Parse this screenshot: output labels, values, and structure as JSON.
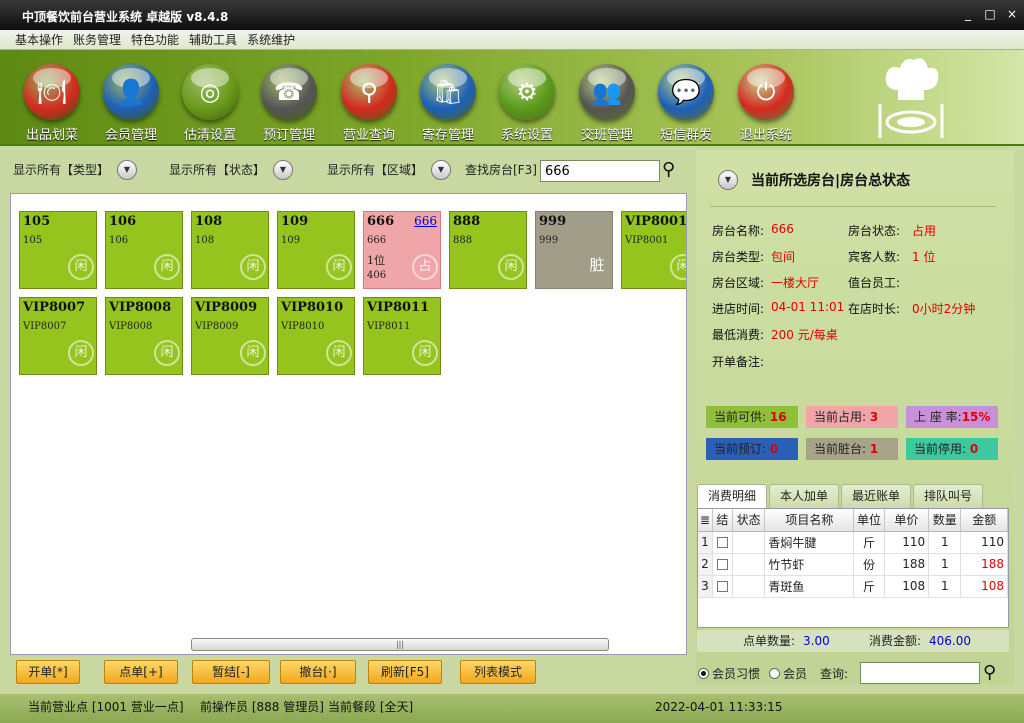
{
  "window": {
    "title": "中顶餐饮前台营业系统 卓越版 v8.4.8",
    "min": "_",
    "max": "□",
    "close": "×"
  },
  "menu": [
    "基本操作",
    "账务管理",
    "特色功能",
    "辅助工具",
    "系统维护"
  ],
  "toolbar": [
    {
      "label": "出品划菜",
      "icon": "dish-cover-icon",
      "glyph": "🍽",
      "color": "#d42a1f"
    },
    {
      "label": "会员管理",
      "icon": "member-icon",
      "glyph": "👤",
      "color": "#1e5fb8"
    },
    {
      "label": "估清设置",
      "icon": "plate-icon",
      "glyph": "◎",
      "color": "#6a9a1a"
    },
    {
      "label": "预订管理",
      "icon": "phone-icon",
      "glyph": "☎",
      "color": "#555555"
    },
    {
      "label": "营业查询",
      "icon": "search-icon",
      "glyph": "⚲",
      "color": "#d42a1f"
    },
    {
      "label": "寄存管理",
      "icon": "bag-icon",
      "glyph": "🛍",
      "color": "#1e5fb8"
    },
    {
      "label": "系统设置",
      "icon": "gear-icon",
      "glyph": "⚙",
      "color": "#5a9a1a"
    },
    {
      "label": "交班管理",
      "icon": "handover-icon",
      "glyph": "👥",
      "color": "#555555"
    },
    {
      "label": "短信群发",
      "icon": "sms-icon",
      "glyph": "💬",
      "color": "#1e5fb8"
    },
    {
      "label": "退出系统",
      "icon": "power-icon",
      "glyph": "⏻",
      "color": "#d42a1f"
    }
  ],
  "filters": {
    "type": "显示所有【类型】",
    "status": "显示所有【状态】",
    "area": "显示所有【区域】",
    "search_label": "查找房台[F3]",
    "search_value": "666",
    "dropdown_glyph": "▼"
  },
  "tables_row1": [
    {
      "no": "105",
      "name": "105",
      "status": "闲",
      "state": "free"
    },
    {
      "no": "106",
      "name": "106",
      "status": "闲",
      "state": "free"
    },
    {
      "no": "108",
      "name": "108",
      "status": "闲",
      "state": "free"
    },
    {
      "no": "109",
      "name": "109",
      "status": "闲",
      "state": "free"
    },
    {
      "no": "666",
      "name": "666",
      "link": "666",
      "guests": "1位",
      "amount": "406",
      "status": "占",
      "state": "occ"
    },
    {
      "no": "888",
      "name": "888",
      "status": "闲",
      "state": "free"
    },
    {
      "no": "999",
      "name": "999",
      "status": "脏",
      "state": "dirty"
    },
    {
      "no": "VIP8001",
      "name": "VIP8001",
      "status": "闲",
      "state": "free"
    }
  ],
  "tables_row2": [
    {
      "no": "VIP8007",
      "name": "VIP8007",
      "status": "闲",
      "state": "free"
    },
    {
      "no": "VIP8008",
      "name": "VIP8008",
      "status": "闲",
      "state": "free"
    },
    {
      "no": "VIP8009",
      "name": "VIP8009",
      "status": "闲",
      "state": "free"
    },
    {
      "no": "VIP8010",
      "name": "VIP8010",
      "status": "闲",
      "state": "free"
    },
    {
      "no": "VIP8011",
      "name": "VIP8011",
      "status": "闲",
      "state": "free"
    }
  ],
  "scroll_grip": "|||",
  "panel": {
    "title": "当前所选房台|房台总状态",
    "room_name_label": "房台名称:",
    "room_name": "666",
    "room_status_label": "房台状态:",
    "room_status": "占用",
    "room_type_label": "房台类型:",
    "room_type": "包间",
    "guests_label": "宾客人数:",
    "guests": "1 位",
    "area_label": "房台区域:",
    "area": "一楼大厅",
    "staff_label": "值台员工:",
    "checkin_label": "进店时间:",
    "checkin": "04-01 11:01",
    "duration_label": "在店时长:",
    "duration": "0小时2分钟",
    "min_label": "最低消费:",
    "min_value": "200 元/每桌",
    "note_label": "开单备注:"
  },
  "stats": [
    {
      "label": "当前可供:",
      "value": "16",
      "bg": "#8ec03a"
    },
    {
      "label": "当前占用:",
      "value": "3",
      "bg": "#f0a5a8"
    },
    {
      "label": "上 座 率:",
      "value": "15%",
      "bg": "#c890d8"
    },
    {
      "label": "当前预订:",
      "value": "0",
      "bg": "#2a5fb8"
    },
    {
      "label": "当前脏台:",
      "value": "1",
      "bg": "#a8a48a"
    },
    {
      "label": "当前停用:",
      "value": "0",
      "bg": "#3ec8a0"
    }
  ],
  "tabs": [
    "消费明细",
    "本人加单",
    "最近账单",
    "排队叫号"
  ],
  "grid": {
    "headers": [
      "≣",
      "结",
      "状态",
      "项目名称",
      "单位",
      "单价",
      "数量",
      "金额"
    ],
    "rows": [
      {
        "n": "1",
        "name": "香焖牛腱",
        "unit": "斤",
        "price": "110",
        "qty": "1",
        "amount": "110",
        "red": false
      },
      {
        "n": "2",
        "name": "竹节虾",
        "unit": "份",
        "price": "188",
        "qty": "1",
        "amount": "188",
        "red": true
      },
      {
        "n": "3",
        "name": "青斑鱼",
        "unit": "斤",
        "price": "108",
        "qty": "1",
        "amount": "108",
        "red": true
      }
    ]
  },
  "summary": {
    "count_label": "点单数量:",
    "count": "3.00",
    "total_label": "消费金额:",
    "total": "406.00"
  },
  "radios": {
    "habit": "会员习惯",
    "member": "会员",
    "query": "查询:"
  },
  "buttons": [
    "开单[*]",
    "点单[+]",
    "暂结[-]",
    "撤台[·]",
    "刷新[F5]",
    "列表模式"
  ],
  "status": {
    "point": "当前营业点 [1001 营业一点]",
    "operator": "前操作员 [888 管理员]",
    "meal": "当前餐段 [全天]",
    "datetime": "2022-04-01 11:33:15"
  }
}
